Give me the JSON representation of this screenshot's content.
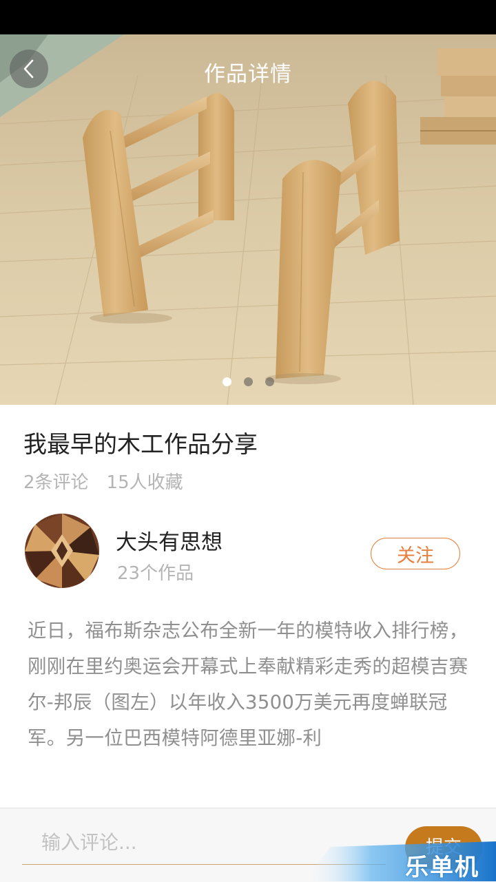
{
  "header": {
    "title": "作品详情",
    "back_icon": "chevron-left-icon"
  },
  "carousel": {
    "image_description": "wooden shelf craft photo",
    "page_count": 3,
    "active_index": 0
  },
  "post": {
    "title": "我最早的木工作品分享",
    "comments": "2条评论",
    "favorites": "15人收藏"
  },
  "author": {
    "name": "大头有思想",
    "works": "23个作品",
    "follow_label": "关注"
  },
  "description": "近日，福布斯杂志公布全新一年的模特收入排行榜，刚刚在里约奥运会开幕式上奉献精彩走秀的超模吉赛尔-邦辰（图左）以年收入3500万美元再度蝉联冠军。另一位巴西模特阿德里亚娜-利",
  "comment_bar": {
    "placeholder": "输入评论...",
    "submit_label": "提交"
  },
  "watermark": {
    "text": "乐单机"
  },
  "colors": {
    "accent": "#e67e3c",
    "submit": "#c47a1d",
    "muted_text": "#b4b4b4"
  }
}
